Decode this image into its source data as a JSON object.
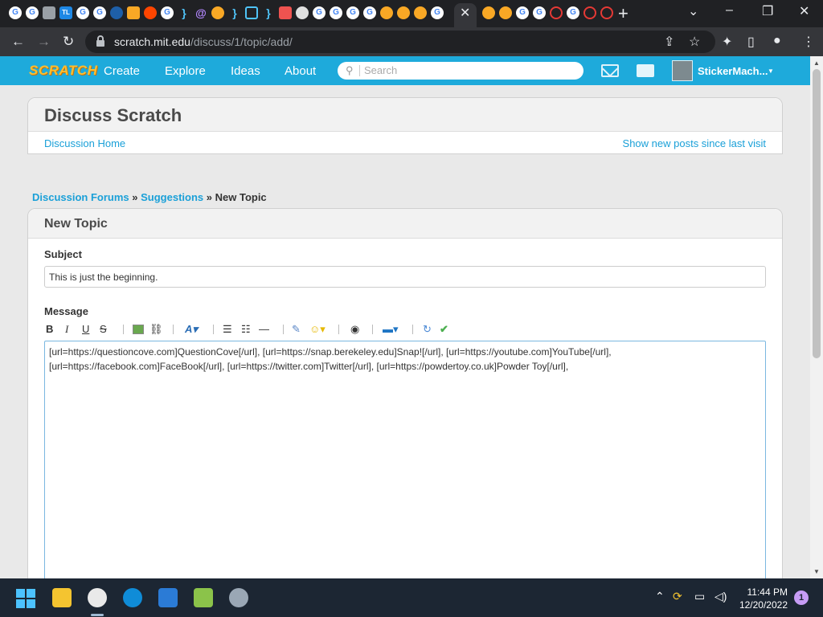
{
  "browser": {
    "url_domain": "scratch.mit.edu",
    "url_path": "/discuss/1/topic/add/",
    "new_tab_label": "+",
    "close_tab_label": "✕",
    "window": {
      "minimize": "–",
      "restore": "❐",
      "close": "✕",
      "tabsearch": "⌄"
    }
  },
  "scratch_nav": {
    "logo": "SCRATCH",
    "links": [
      "Create",
      "Explore",
      "Ideas",
      "About"
    ],
    "search_placeholder": "Search",
    "username": "StickerMach...",
    "caret": "▼"
  },
  "discuss": {
    "title": "Discuss Scratch",
    "home_link": "Discussion Home",
    "show_new_link": "Show new posts since last visit"
  },
  "breadcrumb": {
    "forums": "Discussion Forums",
    "separator": "»",
    "suggestions": "Suggestions",
    "current": "New Topic"
  },
  "topic_form": {
    "heading": "New Topic",
    "subject_label": "Subject",
    "subject_value": "This is just the beginning.",
    "message_label": "Message",
    "message_value": "[url=https://questioncove.com]QuestionCove[/url], [url=https://snap.berekeley.edu]Snap![/url], [url=https://youtube.com]YouTube[/url], [url=https://facebook.com]FaceBook[/url], [url=https://twitter.com]Twitter[/url], [url=https://powdertoy.co.uk]Powder Toy[/url],",
    "toolbar": {
      "bold": "B",
      "italic": "I",
      "underline": "U",
      "strike": "S"
    }
  },
  "taskbar": {
    "time": "11:44 PM",
    "date": "12/20/2022",
    "notifications": "1"
  }
}
